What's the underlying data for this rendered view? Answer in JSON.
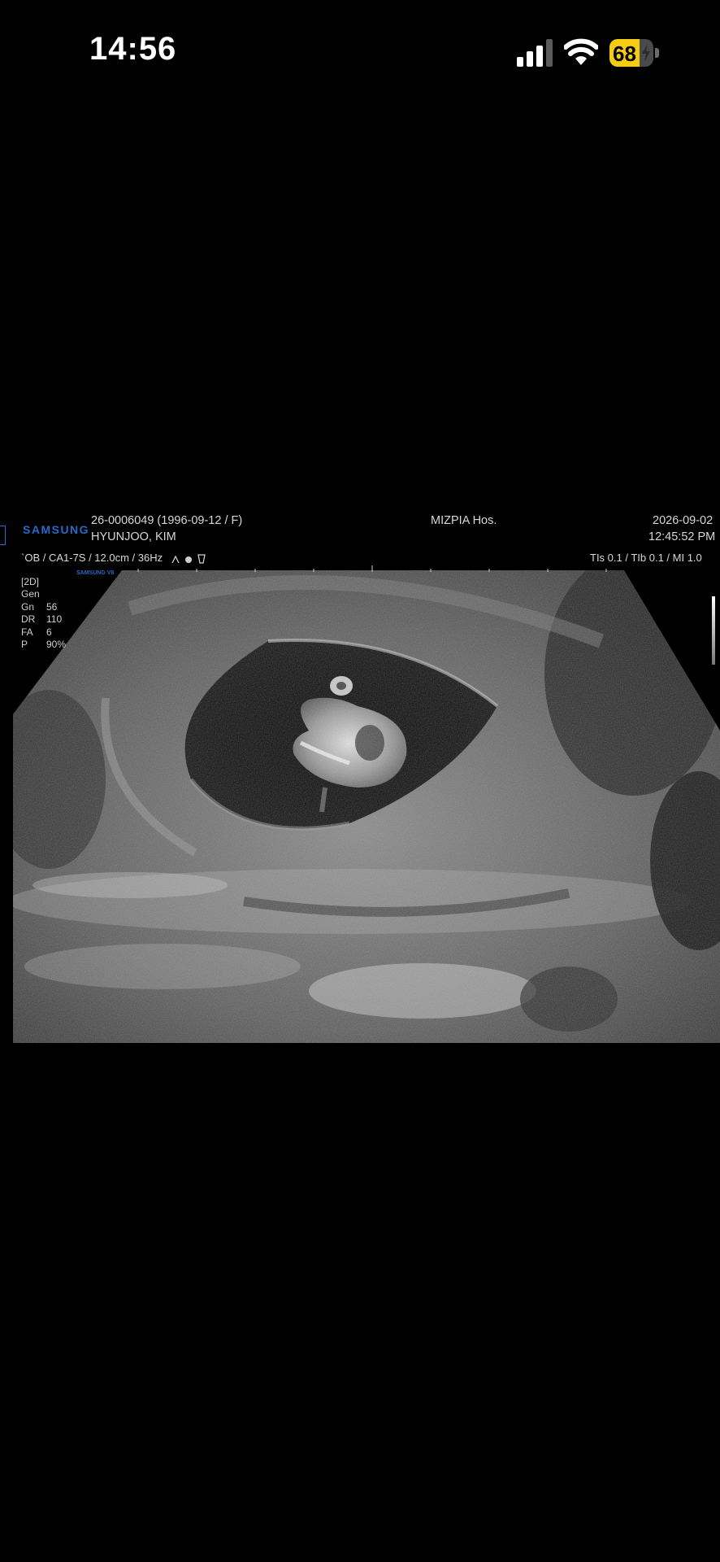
{
  "status_bar": {
    "time": "14:56",
    "battery_percent": "68",
    "battery_level": 0.68,
    "icons": [
      "cellular-signal-icon",
      "wifi-icon",
      "battery-charging-icon"
    ]
  },
  "ultrasound": {
    "brand": "SAMSUNG",
    "brand_small": "SAMSUNG V8",
    "patient_id": "26-0006049 (1996-09-12 / F)",
    "patient_name": "HYUNJOO, KIM",
    "hospital": "MIZPIA Hos.",
    "date": "2026-09-02",
    "time": "12:45:52 PM",
    "probe_info": "`OB / CA1-7S / 12.0cm / 36Hz",
    "thermal_info": "TIs  0.1 / TIb  0.1 / MI   1.0",
    "mode": "[2D]",
    "params": [
      {
        "key": "Gen",
        "value": ""
      },
      {
        "key": "Gn",
        "value": "56"
      },
      {
        "key": "DR",
        "value": "110"
      },
      {
        "key": "FA",
        "value": "6"
      },
      {
        "key": "P",
        "value": "90%"
      }
    ]
  },
  "colors": {
    "background": "#000000",
    "brand_blue": "#2b69c9",
    "battery_yellow": "#f5cc12"
  }
}
